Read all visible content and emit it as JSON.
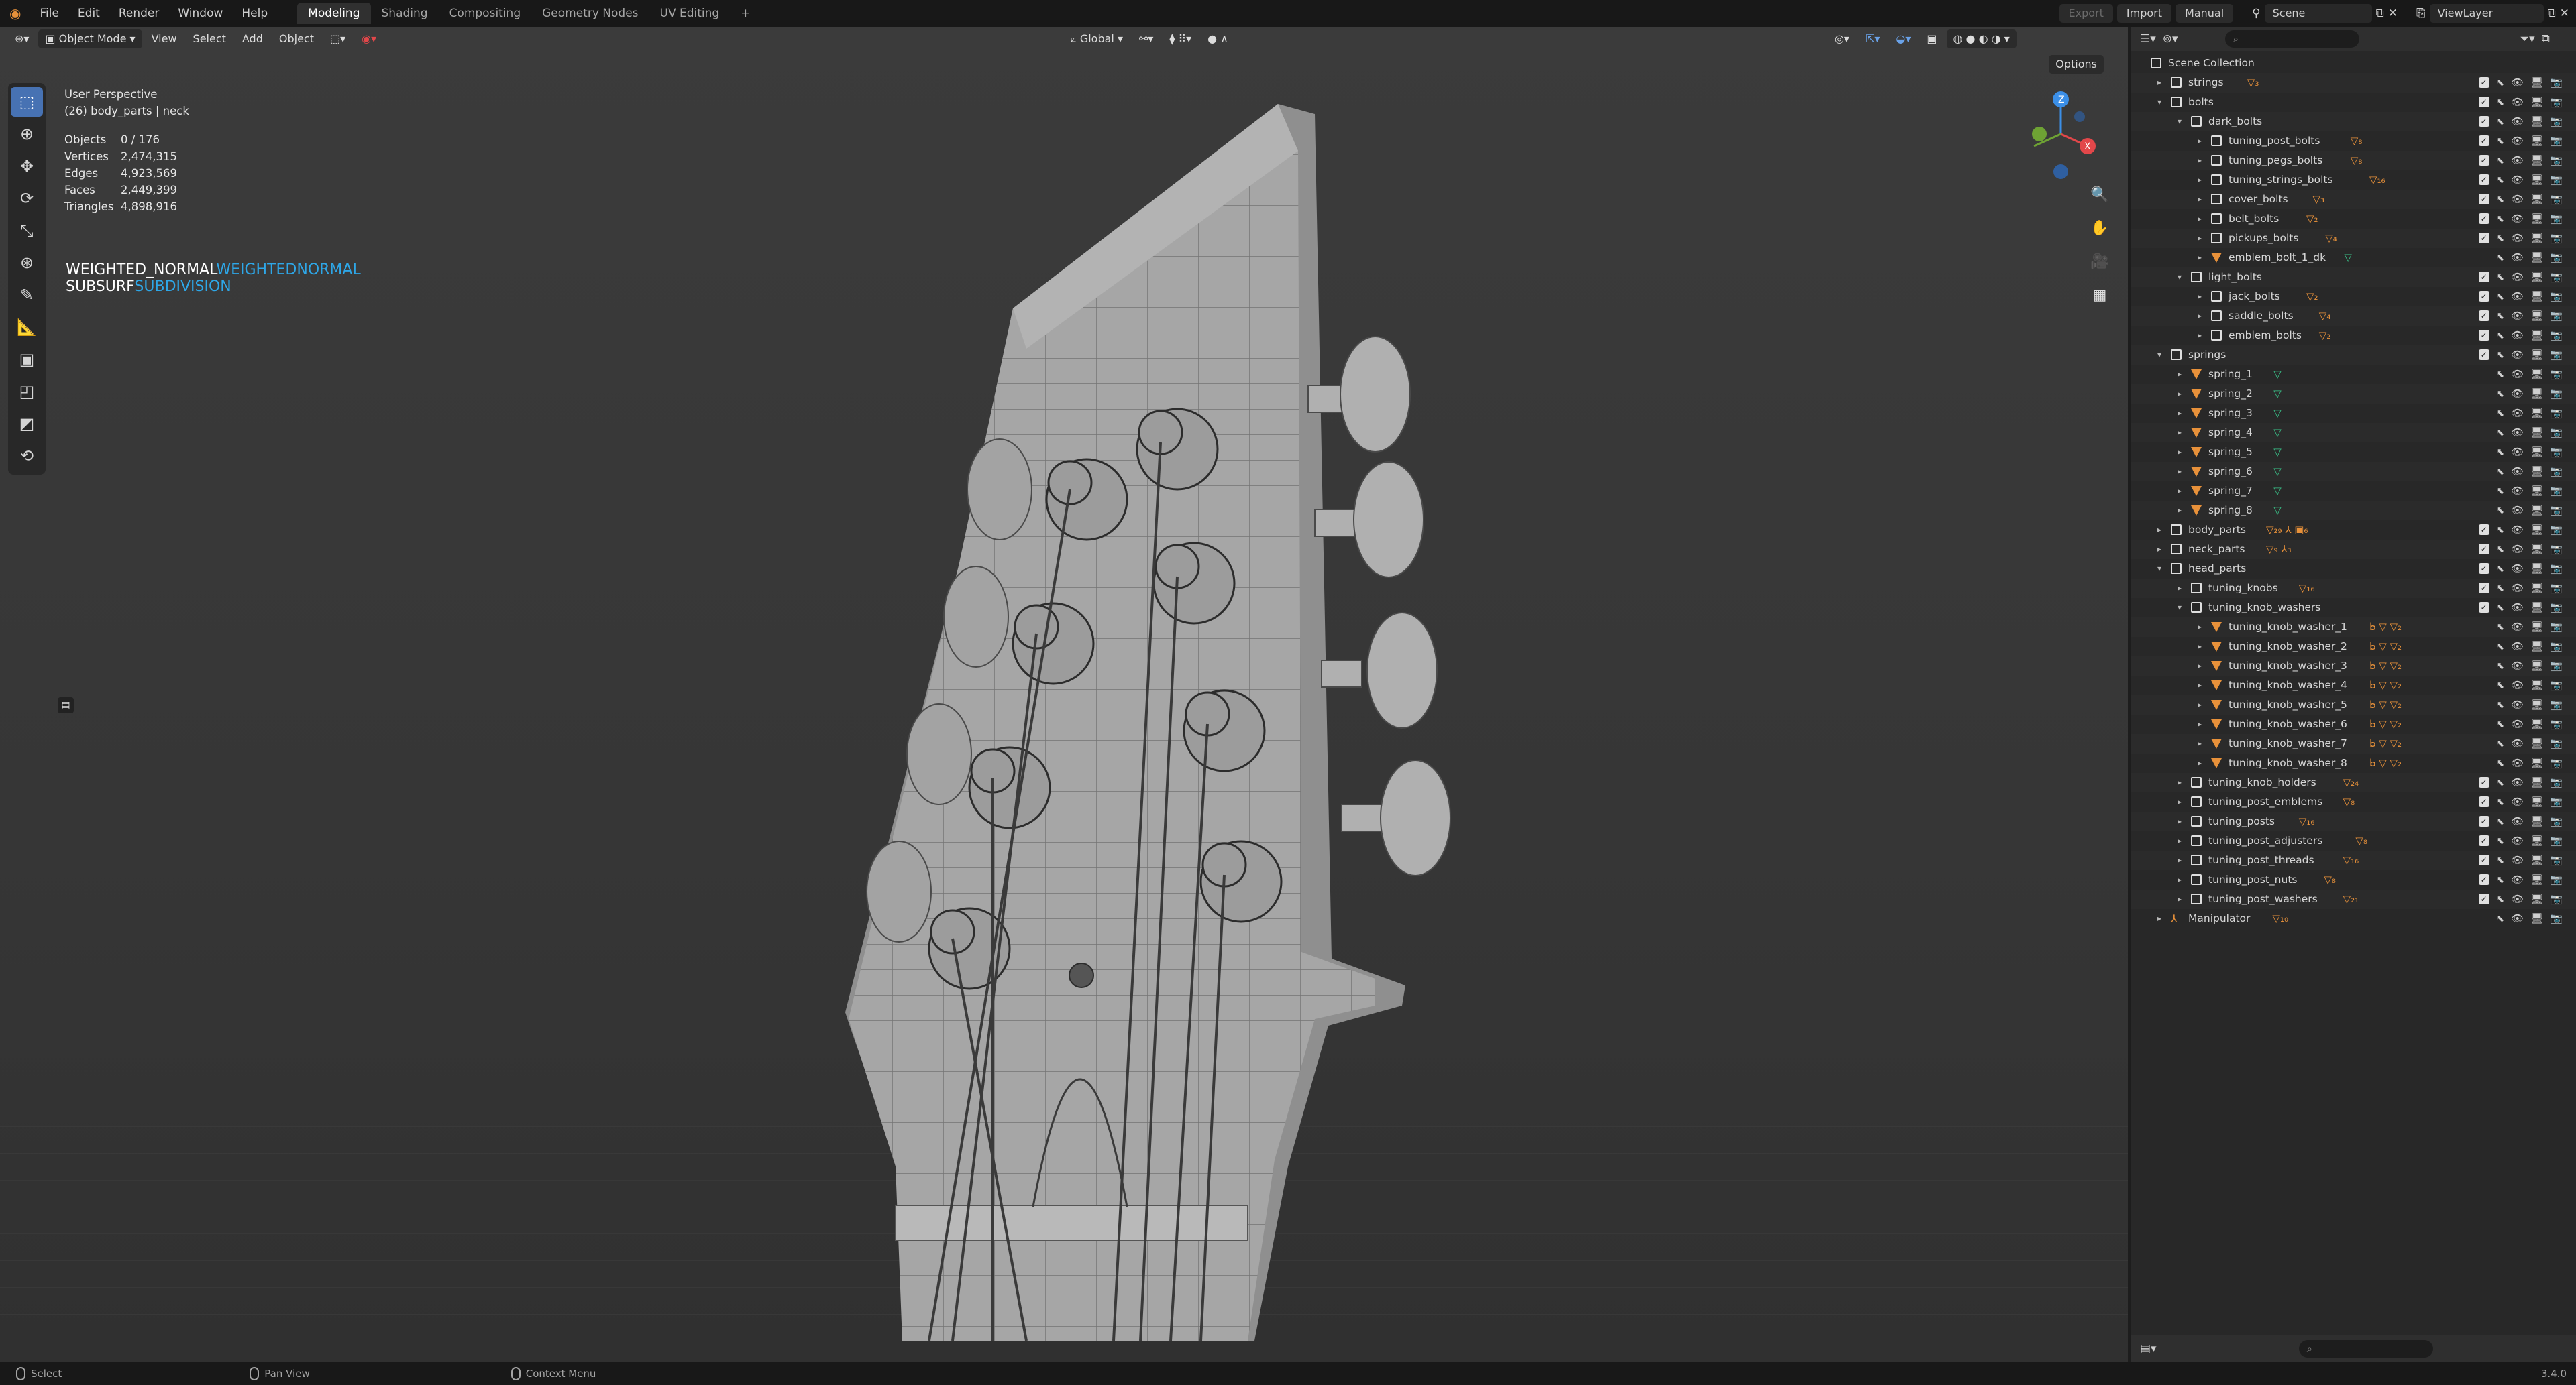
{
  "menubar": {
    "items": [
      "File",
      "Edit",
      "Render",
      "Window",
      "Help"
    ],
    "workspaces": [
      {
        "label": "Modeling",
        "active": true
      },
      {
        "label": "Shading",
        "active": false
      },
      {
        "label": "Compositing",
        "active": false
      },
      {
        "label": "Geometry Nodes",
        "active": false
      },
      {
        "label": "UV Editing",
        "active": false
      }
    ],
    "add_tab": "+",
    "export_label": "Export",
    "import_label": "Import",
    "manual_label": "Manual",
    "scene_name": "Scene",
    "view_layer": "ViewLayer"
  },
  "viewport": {
    "header": {
      "mode": "Object Mode",
      "menus": [
        "View",
        "Select",
        "Add",
        "Object"
      ],
      "transform_orientation": "Global",
      "options_label": "Options"
    },
    "overlay": {
      "perspective": "User Perspective",
      "context": "(26) body_parts | neck",
      "stats": [
        {
          "label": "Objects",
          "value": "0 / 176"
        },
        {
          "label": "Vertices",
          "value": "2,474,315"
        },
        {
          "label": "Edges",
          "value": "4,923,569"
        },
        {
          "label": "Faces",
          "value": "2,449,399"
        },
        {
          "label": "Triangles",
          "value": "4,898,916"
        }
      ],
      "modifiers": [
        {
          "name": "WEIGHTED_NORMAL",
          "type": "WEIGHTEDNORMAL"
        },
        {
          "name": "SUBSURF",
          "type": "SUBDIVISION"
        }
      ]
    },
    "gizmo": {
      "axis_z": "Z",
      "axis_x": "X",
      "axis_y": "Y"
    },
    "colors": {
      "accent": "#4772b3",
      "modifier_type": "#2ea7e8",
      "axis_x": "#e2474a",
      "axis_y": "#6ea234",
      "axis_z": "#3b8fe8"
    }
  },
  "outliner": {
    "search_placeholder": "",
    "rows": [
      {
        "label": "Scene Collection",
        "depth": 0,
        "type": "scene",
        "expanded": true,
        "badge": ""
      },
      {
        "label": "strings",
        "depth": 1,
        "type": "collection",
        "expanded": false,
        "badge": "▽₃"
      },
      {
        "label": "bolts",
        "depth": 1,
        "type": "collection",
        "expanded": true,
        "badge": ""
      },
      {
        "label": "dark_bolts",
        "depth": 2,
        "type": "collection",
        "expanded": true,
        "badge": ""
      },
      {
        "label": "tuning_post_bolts",
        "depth": 3,
        "type": "collection",
        "expanded": false,
        "badge": "▽₈"
      },
      {
        "label": "tuning_pegs_bolts",
        "depth": 3,
        "type": "collection",
        "expanded": false,
        "badge": "▽₈"
      },
      {
        "label": "tuning_strings_bolts",
        "depth": 3,
        "type": "collection",
        "expanded": false,
        "badge": "▽₁₆"
      },
      {
        "label": "cover_bolts",
        "depth": 3,
        "type": "collection",
        "expanded": false,
        "badge": "▽₃"
      },
      {
        "label": "belt_bolts",
        "depth": 3,
        "type": "collection",
        "expanded": false,
        "badge": "▽₂"
      },
      {
        "label": "pickups_bolts",
        "depth": 3,
        "type": "collection",
        "expanded": false,
        "badge": "▽₄"
      },
      {
        "label": "emblem_bolt_1_dk",
        "depth": 3,
        "type": "mesh",
        "expanded": false,
        "badge": "▽",
        "badge_green": true
      },
      {
        "label": "light_bolts",
        "depth": 2,
        "type": "collection",
        "expanded": true,
        "badge": ""
      },
      {
        "label": "jack_bolts",
        "depth": 3,
        "type": "collection",
        "expanded": false,
        "badge": "▽₂"
      },
      {
        "label": "saddle_bolts",
        "depth": 3,
        "type": "collection",
        "expanded": false,
        "badge": "▽₄"
      },
      {
        "label": "emblem_bolts",
        "depth": 3,
        "type": "collection",
        "expanded": false,
        "badge": "▽₂"
      },
      {
        "label": "springs",
        "depth": 1,
        "type": "collection",
        "expanded": true,
        "badge": ""
      },
      {
        "label": "spring_1",
        "depth": 2,
        "type": "mesh",
        "expanded": false,
        "badge": "▽",
        "badge_green": true
      },
      {
        "label": "spring_2",
        "depth": 2,
        "type": "mesh",
        "expanded": false,
        "badge": "▽",
        "badge_green": true
      },
      {
        "label": "spring_3",
        "depth": 2,
        "type": "mesh",
        "expanded": false,
        "badge": "▽",
        "badge_green": true
      },
      {
        "label": "spring_4",
        "depth": 2,
        "type": "mesh",
        "expanded": false,
        "badge": "▽",
        "badge_green": true
      },
      {
        "label": "spring_5",
        "depth": 2,
        "type": "mesh",
        "expanded": false,
        "badge": "▽",
        "badge_green": true
      },
      {
        "label": "spring_6",
        "depth": 2,
        "type": "mesh",
        "expanded": false,
        "badge": "▽",
        "badge_green": true
      },
      {
        "label": "spring_7",
        "depth": 2,
        "type": "mesh",
        "expanded": false,
        "badge": "▽",
        "badge_green": true
      },
      {
        "label": "spring_8",
        "depth": 2,
        "type": "mesh",
        "expanded": false,
        "badge": "▽",
        "badge_green": true
      },
      {
        "label": "body_parts",
        "depth": 1,
        "type": "collection",
        "expanded": false,
        "badge": "▽₂₉ ⅄ ▣₆"
      },
      {
        "label": "neck_parts",
        "depth": 1,
        "type": "collection",
        "expanded": false,
        "badge": "▽₉ ⅄₃"
      },
      {
        "label": "head_parts",
        "depth": 1,
        "type": "collection",
        "expanded": true,
        "badge": ""
      },
      {
        "label": "tuning_knobs",
        "depth": 2,
        "type": "collection",
        "expanded": false,
        "badge": "▽₁₆"
      },
      {
        "label": "tuning_knob_washers",
        "depth": 2,
        "type": "collection",
        "expanded": true,
        "badge": ""
      },
      {
        "label": "tuning_knob_washer_1",
        "depth": 3,
        "type": "mesh",
        "expanded": false,
        "badge": "ᖯ ▽ ▽₂"
      },
      {
        "label": "tuning_knob_washer_2",
        "depth": 3,
        "type": "mesh",
        "expanded": false,
        "badge": "ᖯ ▽ ▽₂"
      },
      {
        "label": "tuning_knob_washer_3",
        "depth": 3,
        "type": "mesh",
        "expanded": false,
        "badge": "ᖯ ▽ ▽₂"
      },
      {
        "label": "tuning_knob_washer_4",
        "depth": 3,
        "type": "mesh",
        "expanded": false,
        "badge": "ᖯ ▽ ▽₂"
      },
      {
        "label": "tuning_knob_washer_5",
        "depth": 3,
        "type": "mesh",
        "expanded": false,
        "badge": "ᖯ ▽ ▽₂"
      },
      {
        "label": "tuning_knob_washer_6",
        "depth": 3,
        "type": "mesh",
        "expanded": false,
        "badge": "ᖯ ▽ ▽₂"
      },
      {
        "label": "tuning_knob_washer_7",
        "depth": 3,
        "type": "mesh",
        "expanded": false,
        "badge": "ᖯ ▽ ▽₂"
      },
      {
        "label": "tuning_knob_washer_8",
        "depth": 3,
        "type": "mesh",
        "expanded": false,
        "badge": "ᖯ ▽ ▽₂"
      },
      {
        "label": "tuning_knob_holders",
        "depth": 2,
        "type": "collection",
        "expanded": false,
        "badge": "▽₂₄"
      },
      {
        "label": "tuning_post_emblems",
        "depth": 2,
        "type": "collection",
        "expanded": false,
        "badge": "▽₈"
      },
      {
        "label": "tuning_posts",
        "depth": 2,
        "type": "collection",
        "expanded": false,
        "badge": "▽₁₆"
      },
      {
        "label": "tuning_post_adjusters",
        "depth": 2,
        "type": "collection",
        "expanded": false,
        "badge": "▽₈"
      },
      {
        "label": "tuning_post_threads",
        "depth": 2,
        "type": "collection",
        "expanded": false,
        "badge": "▽₁₆"
      },
      {
        "label": "tuning_post_nuts",
        "depth": 2,
        "type": "collection",
        "expanded": false,
        "badge": "▽₈"
      },
      {
        "label": "tuning_post_washers",
        "depth": 2,
        "type": "collection",
        "expanded": false,
        "badge": "▽₂₁"
      },
      {
        "label": "Manipulator",
        "depth": 1,
        "type": "armature",
        "expanded": false,
        "badge": "▽₁₀"
      }
    ]
  },
  "statusbar": {
    "select": "Select",
    "pan": "Pan View",
    "context": "Context Menu",
    "version": "3.4.0"
  }
}
